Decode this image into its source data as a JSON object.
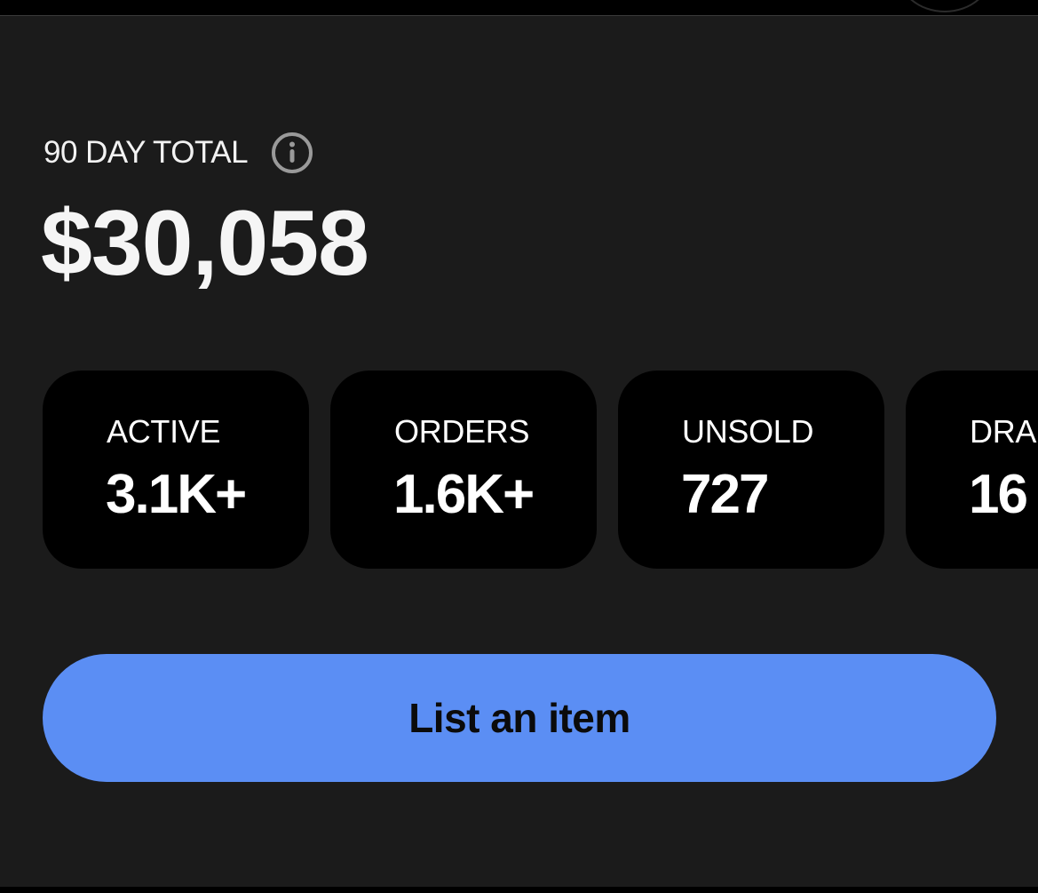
{
  "summary": {
    "label": "90 DAY TOTAL",
    "info_icon": "info-icon",
    "total": "$30,058"
  },
  "stats": [
    {
      "label": "ACTIVE",
      "value": "3.1K+"
    },
    {
      "label": "ORDERS",
      "value": "1.6K+"
    },
    {
      "label": "UNSOLD",
      "value": "727"
    },
    {
      "label": "DRA",
      "value": "16"
    }
  ],
  "actions": {
    "list_item_label": "List an item"
  },
  "colors": {
    "background": "#1b1b1b",
    "card": "#000000",
    "accent": "#5b8ef4",
    "text": "#ffffff"
  }
}
